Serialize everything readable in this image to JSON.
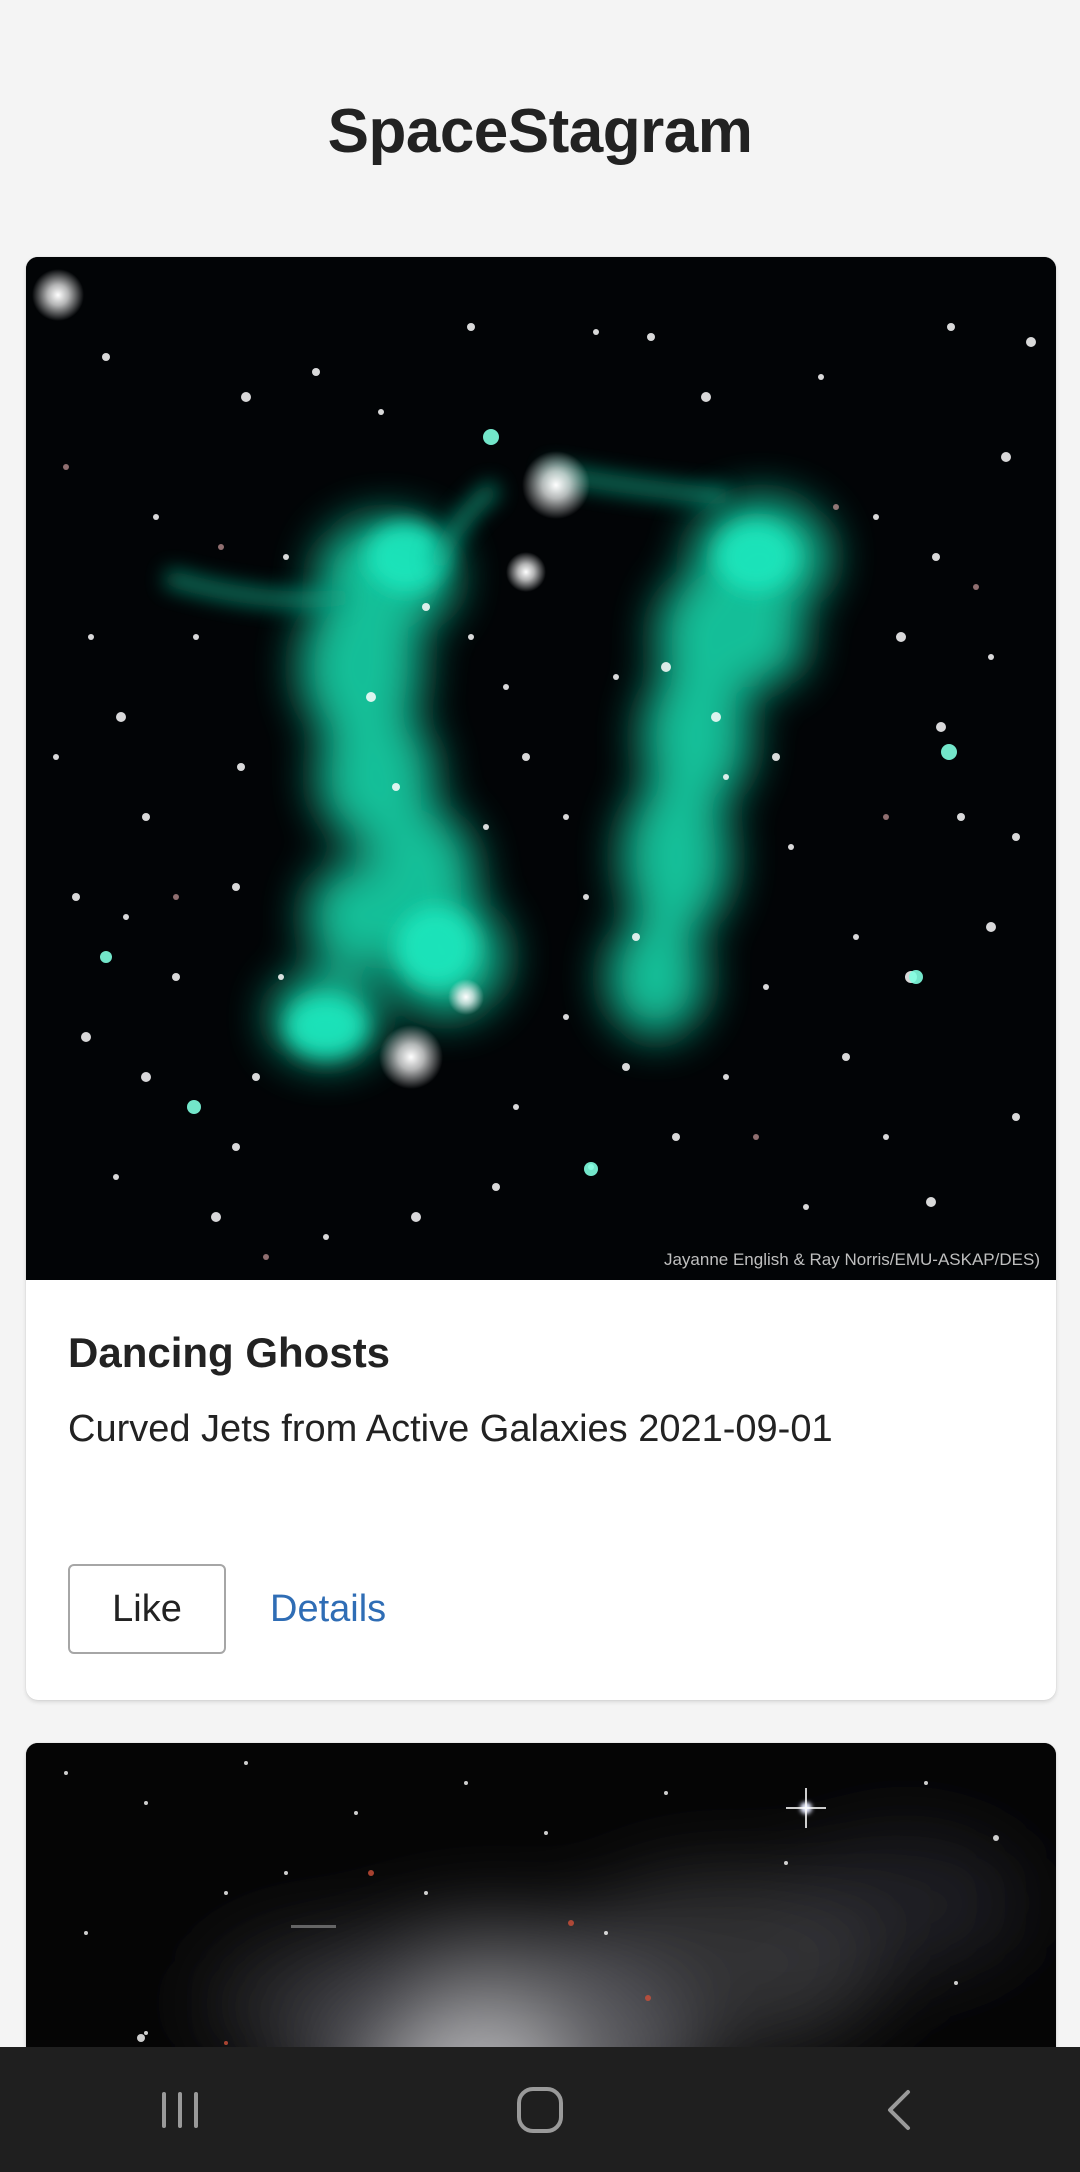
{
  "app": {
    "title": "SpaceStagram"
  },
  "posts": [
    {
      "title": "Dancing Ghosts",
      "subtitle": "Curved Jets from Active Galaxies 2021-09-01",
      "image_credit": "Jayanne English & Ray Norris/EMU-ASKAP/DES)",
      "like_label": "Like",
      "details_label": "Details"
    },
    {
      "title": "",
      "subtitle": ""
    }
  ],
  "nav_bar": {
    "recents_icon": "recents-icon",
    "home_icon": "home-icon",
    "back_icon": "back-icon"
  },
  "colors": {
    "background": "#f4f4f4",
    "link": "#2f6db5",
    "nav_bar": "#1f1f1f",
    "jet_color": "#1ee0b4"
  }
}
